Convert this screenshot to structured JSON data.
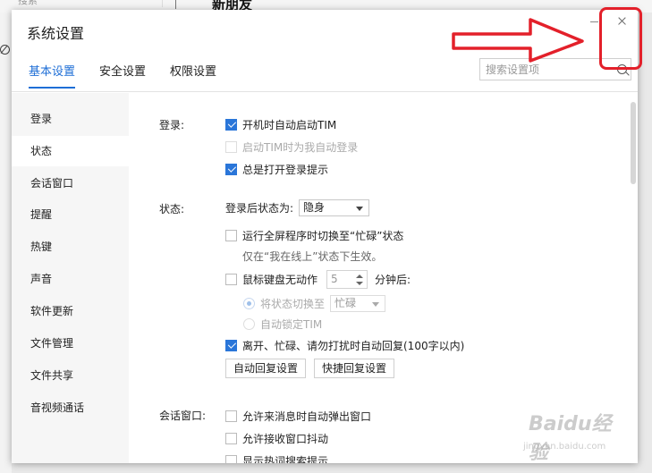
{
  "background_app": {
    "search_placeholder": "搜索",
    "title": "新朋友"
  },
  "dialog": {
    "title": "系统设置",
    "tabs": [
      {
        "label": "基本设置",
        "active": true
      },
      {
        "label": "安全设置",
        "active": false
      },
      {
        "label": "权限设置",
        "active": false
      }
    ],
    "search": {
      "placeholder": "搜索设置项",
      "value": ""
    }
  },
  "sidebar": {
    "items": [
      {
        "label": "登录",
        "selected": false
      },
      {
        "label": "状态",
        "selected": true
      },
      {
        "label": "会话窗口",
        "selected": false
      },
      {
        "label": "提醒",
        "selected": false
      },
      {
        "label": "热键",
        "selected": false
      },
      {
        "label": "声音",
        "selected": false
      },
      {
        "label": "软件更新",
        "selected": false
      },
      {
        "label": "文件管理",
        "selected": false
      },
      {
        "label": "文件共享",
        "selected": false
      },
      {
        "label": "音视频通话",
        "selected": false
      }
    ]
  },
  "login": {
    "label": "登录:",
    "auto_start": {
      "label": "开机时自动启动TIM",
      "checked": true
    },
    "auto_login": {
      "label": "启动TIM时为我自动登录",
      "checked": false,
      "disabled": true
    },
    "show_tip": {
      "label": "总是打开登录提示",
      "checked": true
    }
  },
  "status": {
    "label": "状态:",
    "after_login_label": "登录后状态为:",
    "after_login_value": "隐身",
    "fullscreen_busy": {
      "label": "运行全屏程序时切换至“忙碌”状态",
      "checked": false
    },
    "fullscreen_hint": "仅在“我在线上”状态下生效。",
    "idle": {
      "label": "鼠标键盘无动作",
      "checked": false,
      "minutes": "5",
      "suffix": "分钟后:"
    },
    "switch_to": {
      "label": "将状态切换至",
      "selected": true,
      "value": "忙碌"
    },
    "auto_lock": {
      "label": "自动锁定TIM",
      "selected": false
    },
    "auto_reply": {
      "label": "离开、忙碌、请勿打扰时自动回复(100字以内)",
      "checked": true
    },
    "auto_reply_btn": "自动回复设置",
    "quick_reply_btn": "快捷回复设置"
  },
  "chat_window": {
    "label": "会话窗口:",
    "popup": {
      "label": "允许来消息时自动弹出窗口",
      "checked": false
    },
    "shake": {
      "label": "允许接收窗口抖动",
      "checked": false
    },
    "hot_words": {
      "label": "显示热词搜索提示",
      "checked": false
    }
  },
  "watermark": {
    "brand": "Baidu经验",
    "url": "jingyan.baidu.com"
  },
  "colors": {
    "accent": "#1e6ed6",
    "checkbox": "#2a76d9",
    "annotation": "#e3202a"
  }
}
